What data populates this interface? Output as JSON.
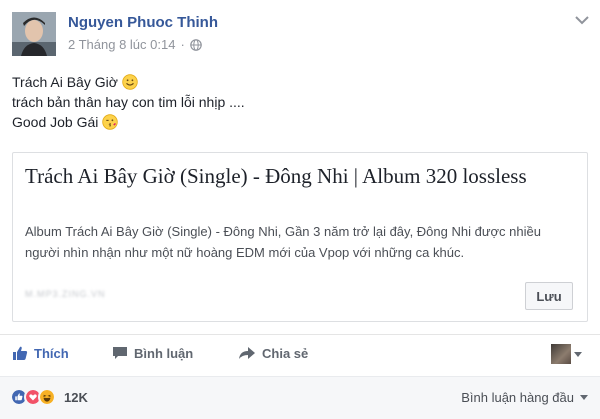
{
  "post": {
    "author": "Nguyen Phuoc Thinh",
    "timestamp": "2 Tháng 8 lúc 0:14",
    "privacy_icon": "globe-icon",
    "menu_icon": "chevron-down-icon",
    "lines": [
      {
        "text": "Trách Ai Bây Giờ",
        "emoji": "smile-emoji"
      },
      {
        "text": "trách bản thân hay con tim lỗi nhịp ....",
        "emoji": null
      },
      {
        "text": "Good Job Gái",
        "emoji": "kiss-emoji"
      }
    ]
  },
  "link_card": {
    "title": "Trách Ai Bây Giờ (Single) - Đông Nhi | Album 320 lossless",
    "description": "Album Trách Ai Bây Giờ (Single) - Đông Nhi, Gần 3 năm trở lại đây, Đông Nhi được nhiều người nhìn nhận như một nữ hoàng EDM mới của Vpop với những ca khúc.",
    "domain": "M.MP3.ZING.VN",
    "save_label": "Lưu"
  },
  "actions": {
    "like_label": "Thích",
    "comment_label": "Bình luận",
    "share_label": "Chia sẻ"
  },
  "reactions": {
    "types": [
      "like",
      "love",
      "haha"
    ],
    "count": "12K",
    "sort_label": "Bình luận hàng đầu"
  },
  "colors": {
    "brand_blue": "#4267b2",
    "name_blue": "#365899",
    "love_red": "#f25268",
    "haha_yellow": "#f7b125"
  }
}
